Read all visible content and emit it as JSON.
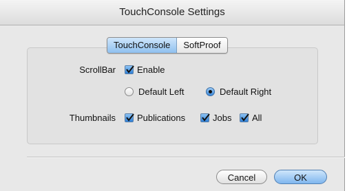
{
  "window": {
    "title": "TouchConsole Settings"
  },
  "tabs": [
    {
      "label": "TouchConsole",
      "selected": true
    },
    {
      "label": "SoftProof",
      "selected": false
    }
  ],
  "scrollbar": {
    "label": "ScrollBar",
    "enable": {
      "label": "Enable",
      "checked": true
    },
    "position_options": [
      {
        "label": "Default Left",
        "selected": false
      },
      {
        "label": "Default Right",
        "selected": true
      }
    ]
  },
  "thumbnails": {
    "label": "Thumbnails",
    "options": [
      {
        "label": "Publications",
        "checked": true
      },
      {
        "label": "Jobs",
        "checked": true
      },
      {
        "label": "All",
        "checked": true
      }
    ]
  },
  "buttons": {
    "cancel": "Cancel",
    "ok": "OK"
  },
  "colors": {
    "accent": "#3a86d8",
    "window_bg": "#e8e8e8"
  }
}
